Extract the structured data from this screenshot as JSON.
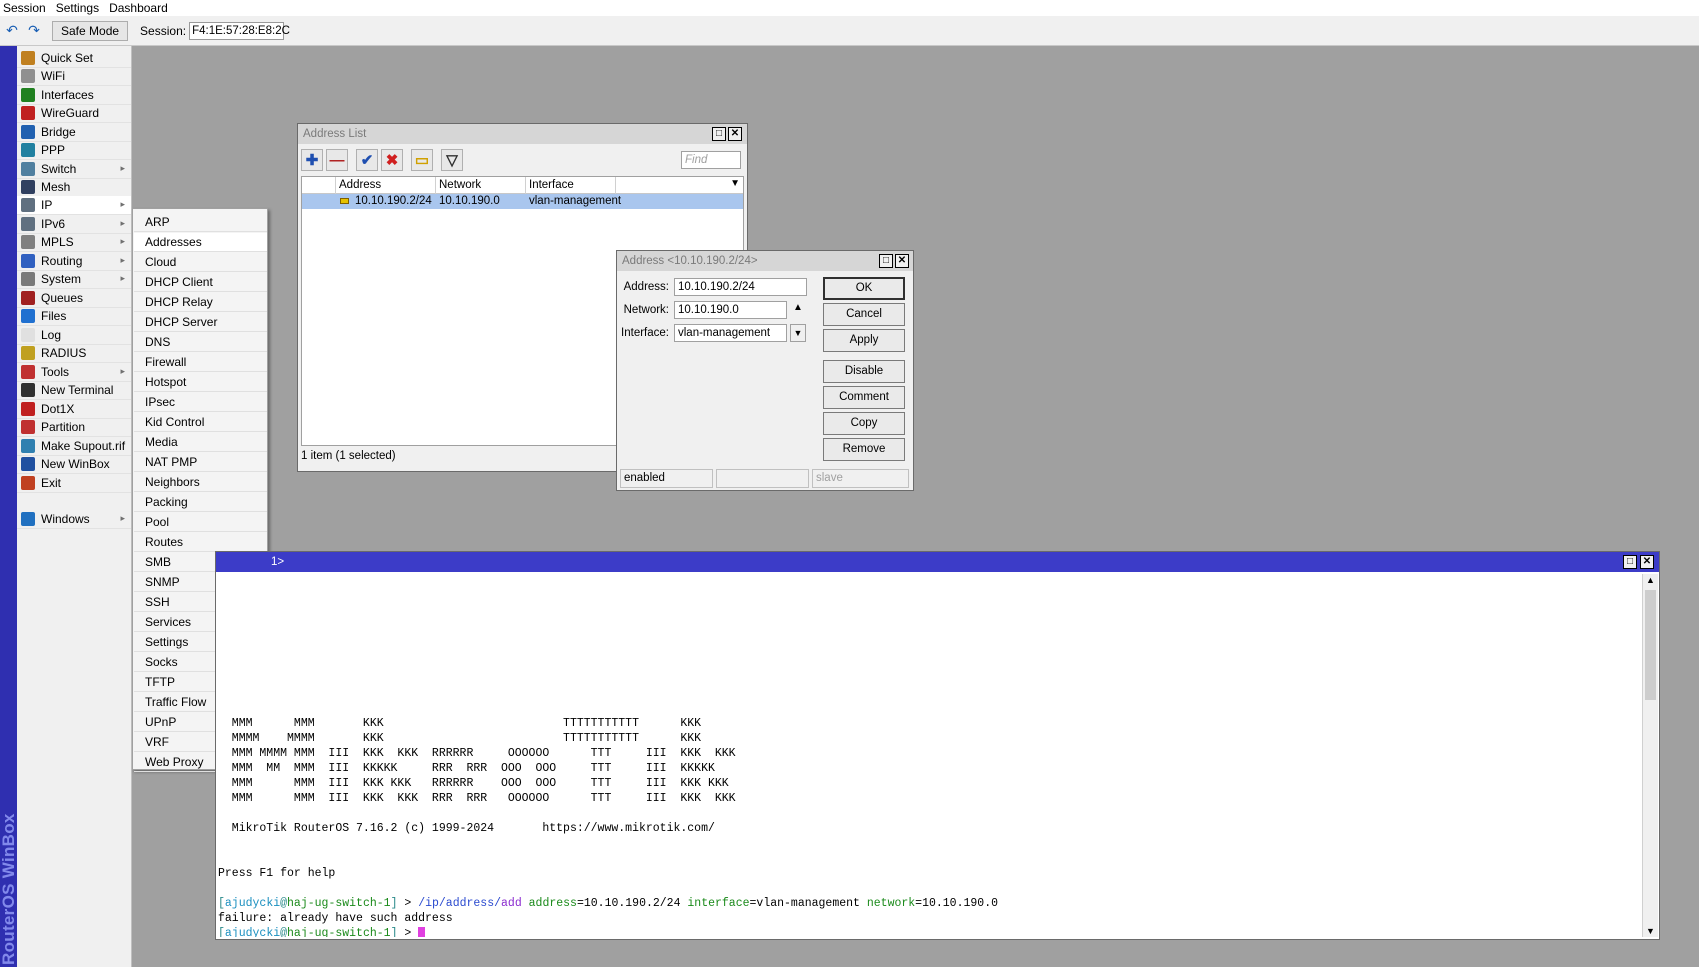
{
  "menubar": [
    "Session",
    "Settings",
    "Dashboard"
  ],
  "toolbar": {
    "undo_icon": "undo-icon",
    "redo_icon": "redo-icon",
    "safe_mode_label": "Safe Mode",
    "session_label": "Session:",
    "session_value": "F4:1E:57:28:E8:2C"
  },
  "brand_text": "RouterOS WinBox",
  "nav": [
    {
      "label": "Quick Set",
      "icon": "quick-set-icon",
      "color": "#c08020",
      "arrow": false
    },
    {
      "label": "WiFi",
      "icon": "wifi-icon",
      "color": "#909090",
      "arrow": false
    },
    {
      "label": "Interfaces",
      "icon": "interfaces-icon",
      "color": "#208020",
      "arrow": false
    },
    {
      "label": "WireGuard",
      "icon": "wireguard-icon",
      "color": "#c02020",
      "arrow": false
    },
    {
      "label": "Bridge",
      "icon": "bridge-icon",
      "color": "#2060b0",
      "arrow": false
    },
    {
      "label": "PPP",
      "icon": "ppp-icon",
      "color": "#2080a0",
      "arrow": false
    },
    {
      "label": "Switch",
      "icon": "switch-icon",
      "color": "#5080a0",
      "arrow": true
    },
    {
      "label": "Mesh",
      "icon": "mesh-icon",
      "color": "#304060",
      "arrow": false
    },
    {
      "label": "IP",
      "icon": "ip-icon",
      "color": "#607080",
      "arrow": true
    },
    {
      "label": "IPv6",
      "icon": "ipv6-icon",
      "color": "#607080",
      "arrow": true
    },
    {
      "label": "MPLS",
      "icon": "mpls-icon",
      "color": "#808080",
      "arrow": true
    },
    {
      "label": "Routing",
      "icon": "routing-icon",
      "color": "#3060c0",
      "arrow": true
    },
    {
      "label": "System",
      "icon": "system-icon",
      "color": "#7a7a7a",
      "arrow": true
    },
    {
      "label": "Queues",
      "icon": "queues-icon",
      "color": "#a02020",
      "arrow": false
    },
    {
      "label": "Files",
      "icon": "files-icon",
      "color": "#2070d0",
      "arrow": false
    },
    {
      "label": "Log",
      "icon": "log-icon",
      "color": "#e0e0e0",
      "arrow": false
    },
    {
      "label": "RADIUS",
      "icon": "radius-icon",
      "color": "#c0a020",
      "arrow": false
    },
    {
      "label": "Tools",
      "icon": "tools-icon",
      "color": "#c03030",
      "arrow": true
    },
    {
      "label": "New Terminal",
      "icon": "terminal-icon",
      "color": "#303030",
      "arrow": false
    },
    {
      "label": "Dot1X",
      "icon": "dot1x-icon",
      "color": "#c02020",
      "arrow": false
    },
    {
      "label": "Partition",
      "icon": "partition-icon",
      "color": "#c03030",
      "arrow": false
    },
    {
      "label": "Make Supout.rif",
      "icon": "supout-icon",
      "color": "#3080b0",
      "arrow": false
    },
    {
      "label": "New WinBox",
      "icon": "winbox-icon",
      "color": "#2050a0",
      "arrow": false
    },
    {
      "label": "Exit",
      "icon": "exit-icon",
      "color": "#c04020",
      "arrow": false
    }
  ],
  "nav_windows": {
    "label": "Windows",
    "icon": "windows-icon",
    "color": "#2070c0"
  },
  "ip_submenu": [
    "ARP",
    "Addresses",
    "Cloud",
    "DHCP Client",
    "DHCP Relay",
    "DHCP Server",
    "DNS",
    "Firewall",
    "Hotspot",
    "IPsec",
    "Kid Control",
    "Media",
    "NAT PMP",
    "Neighbors",
    "Packing",
    "Pool",
    "Routes",
    "SMB",
    "SNMP",
    "SSH",
    "Services",
    "Settings",
    "Socks",
    "TFTP",
    "Traffic Flow",
    "UPnP",
    "VRF",
    "Web Proxy"
  ],
  "address_list": {
    "title": "Address List",
    "find_placeholder": "Find",
    "columns": [
      "Address",
      "Network",
      "Interface"
    ],
    "rows": [
      {
        "address": "10.10.190.2/24",
        "network": "10.10.190.0",
        "interface": "vlan-management"
      }
    ],
    "status": "1 item (1 selected)"
  },
  "address_dialog": {
    "title": "Address <10.10.190.2/24>",
    "address_label": "Address:",
    "address_value": "10.10.190.2/24",
    "network_label": "Network:",
    "network_value": "10.10.190.0",
    "interface_label": "Interface:",
    "interface_value": "vlan-management",
    "buttons": [
      "OK",
      "Cancel",
      "Apply",
      "Disable",
      "Comment",
      "Copy",
      "Remove"
    ],
    "status": [
      "enabled",
      "",
      "slave"
    ]
  },
  "terminal": {
    "title": "1>",
    "banner": [
      "  MMM      MMM       KKK                          TTTTTTTTTTT      KKK",
      "  MMMM    MMMM       KKK                          TTTTTTTTTTT      KKK",
      "  MMM MMMM MMM  III  KKK  KKK  RRRRRR     OOOOOO      TTT     III  KKK  KKK",
      "  MMM  MM  MMM  III  KKKKK     RRR  RRR  OOO  OOO     TTT     III  KKKKK",
      "  MMM      MMM  III  KKK KKK   RRRRRR    OOO  OOO     TTT     III  KKK KKK",
      "  MMM      MMM  III  KKK  KKK  RRR  RRR   OOOOOO      TTT     III  KKK  KKK"
    ],
    "copyright": "  MikroTik RouterOS 7.16.2 (c) 1999-2024       https://www.mikrotik.com/",
    "help": "Press F1 for help",
    "user": "ajudycki",
    "host": "haj-ug-switch-1",
    "cmd_path": "/ip/address/",
    "cmd_verb": "add",
    "args": [
      {
        "k": "address",
        "v": "10.10.190.2/24"
      },
      {
        "k": "interface",
        "v": "vlan-management"
      },
      {
        "k": "network",
        "v": "10.10.190.0"
      }
    ],
    "failure": "failure: already have such address"
  }
}
